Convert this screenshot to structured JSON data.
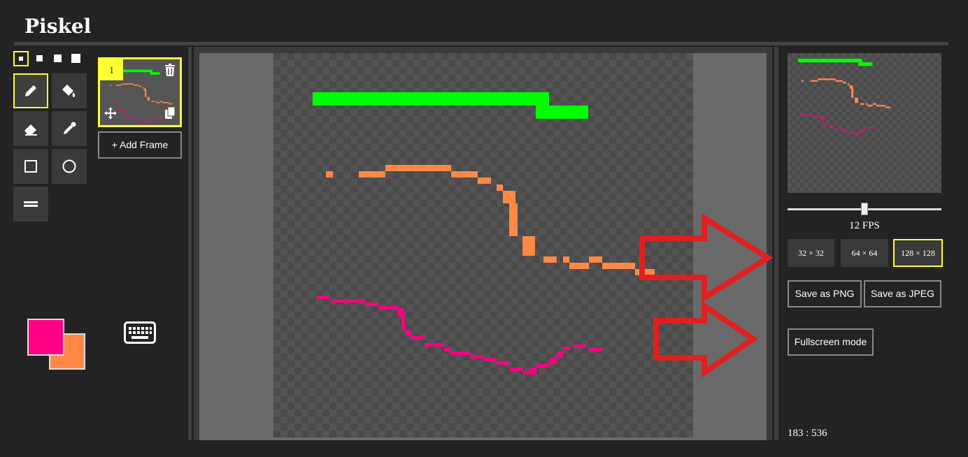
{
  "app": {
    "title": "Piskel"
  },
  "frames": {
    "items": [
      {
        "number": "1"
      }
    ],
    "add_label": "+ Add Frame"
  },
  "colors": {
    "primary": "#ff0084",
    "secondary": "#ff8847",
    "accent": "#ffff33",
    "stroke_green": "#00ff00",
    "stroke_orange": "#ff8847",
    "stroke_pink": "#ff0084"
  },
  "tools": [
    "pen-tool",
    "paint-bucket-tool",
    "eraser-tool",
    "eyedropper-tool",
    "rectangle-tool",
    "circle-tool",
    "stroke-tool"
  ],
  "animation": {
    "fps_label": "12 FPS",
    "fps_value": 12
  },
  "resize": {
    "options": [
      {
        "label": "32 × 32"
      },
      {
        "label": "64 × 64"
      },
      {
        "label": "128 × 128",
        "selected": true
      }
    ]
  },
  "export": {
    "png_label": "Save as PNG",
    "jpeg_label": "Save as JPEG",
    "fullscreen_label": "Fullscreen mode"
  },
  "status": {
    "coordinates": "183 : 536"
  }
}
